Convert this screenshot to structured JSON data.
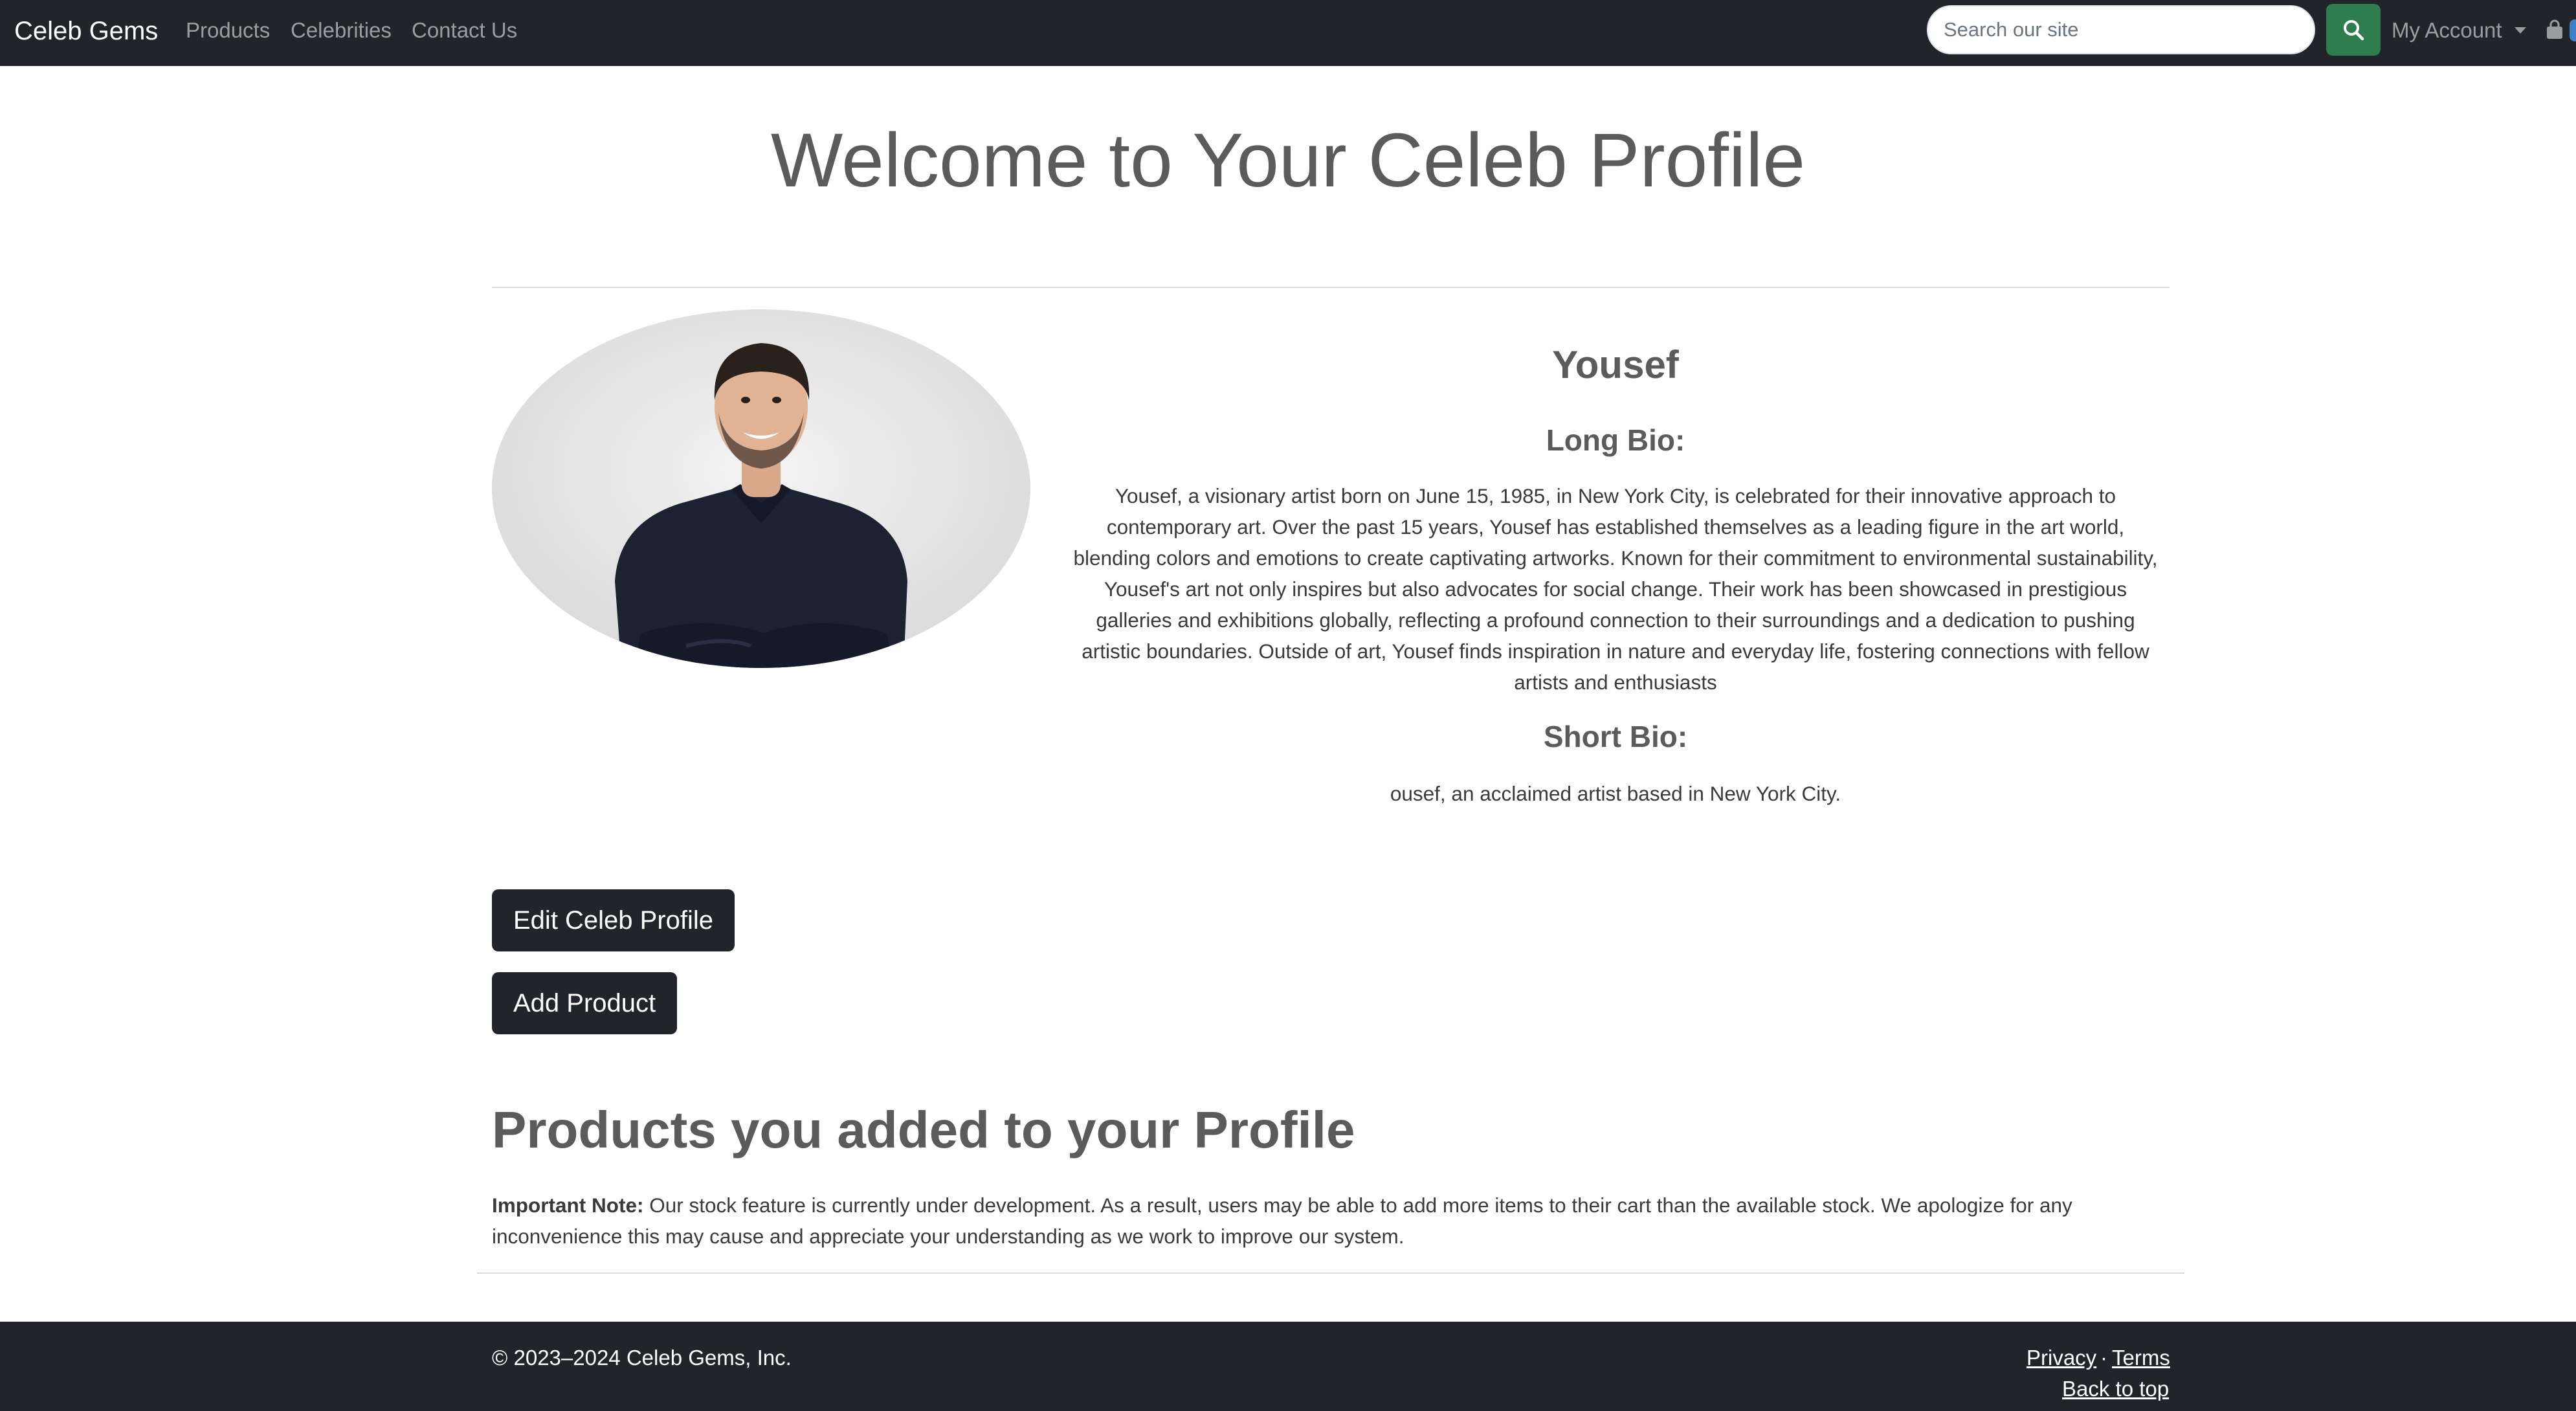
{
  "navbar": {
    "brand": "Celeb Gems",
    "links": [
      "Products",
      "Celebrities",
      "Contact Us"
    ],
    "search": {
      "placeholder": "Search our site",
      "button_icon": "search-icon"
    },
    "account_label": "My Account",
    "cart_icon": "shopping-bag-icon",
    "colors": {
      "background": "#212529",
      "search_button": "#2f7d4f"
    }
  },
  "main": {
    "page_title": "Welcome to Your Celeb Profile",
    "profile": {
      "name": "Yousef",
      "long_bio_heading": "Long Bio:",
      "long_bio": "Yousef, a visionary artist born on June 15, 1985, in New York City, is celebrated for their innovative approach to contemporary art. Over the past 15 years, Yousef has established themselves as a leading figure in the art world, blending colors and emotions to create captivating artworks. Known for their commitment to environmental sustainability, Yousef's art not only inspires but also advocates for social change. Their work has been showcased in prestigious galleries and exhibitions globally, reflecting a profound connection to their surroundings and a dedication to pushing artistic boundaries. Outside of art, Yousef finds inspiration in nature and everyday life, fostering connections with fellow artists and enthusiasts",
      "short_bio_heading": "Short Bio:",
      "short_bio": "ousef, an acclaimed artist based in New York City."
    },
    "buttons": {
      "edit_profile": "Edit Celeb Profile",
      "add_product": "Add Product"
    },
    "products_section": {
      "title": "Products you added to your Profile",
      "note_label": "Important Note:",
      "note_text": " Our stock feature is currently under development. As a result, users may be able to add more items to their cart than the available stock. We apologize for any inconvenience this may cause and appreciate your understanding as we work to improve our system."
    }
  },
  "footer": {
    "copyright": "© 2023–2024 Celeb Gems, Inc.",
    "privacy": "Privacy",
    "separator": "·",
    "terms": "Terms",
    "back_to_top": "Back to top"
  }
}
